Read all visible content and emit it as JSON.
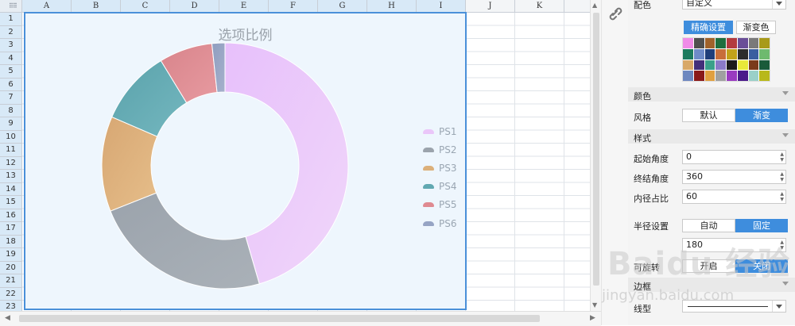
{
  "sheet": {
    "columns": [
      "A",
      "B",
      "C",
      "D",
      "E",
      "F",
      "G",
      "H",
      "I",
      "J",
      "K"
    ],
    "rows": [
      "1",
      "2",
      "3",
      "4",
      "5",
      "6",
      "7",
      "8",
      "9",
      "10",
      "11",
      "12",
      "13",
      "14",
      "15",
      "16",
      "17",
      "18",
      "19",
      "20",
      "21",
      "22",
      "23"
    ]
  },
  "chart_data": {
    "type": "pie",
    "title": "选项比例",
    "donut": true,
    "categories": [
      "PS1",
      "PS2",
      "PS3",
      "PS4",
      "PS5",
      "PS6"
    ],
    "values": [
      45.5,
      23.5,
      12.5,
      9.8,
      7.0,
      1.7
    ],
    "colors": [
      "#eac6f9",
      "#9ba3ac",
      "#dcb07a",
      "#61a8b1",
      "#df8a91",
      "#96a4c4"
    ],
    "start_angle": 0,
    "end_angle": 360,
    "inner_radius_pct": 60,
    "legend_position": "right"
  },
  "panel": {
    "color_scheme_label": "配色",
    "color_scheme_value": "自定义",
    "precise_button": "精确设置",
    "gradient_button": "渐变色",
    "palette": [
      "#f08ce8",
      "#505050",
      "#a0622a",
      "#1f6e3e",
      "#b33b3f",
      "#6a4e97",
      "#7a7a7a",
      "#a89a1a",
      "#1c7a5e",
      "#6e8bc8",
      "#1f3e7a",
      "#c86e3a",
      "#c2a21a",
      "#2c2c2c",
      "#3a5fa0",
      "#6eba6e",
      "#d8a868",
      "#42307a",
      "#3aa08a",
      "#8a7ac8",
      "#1a1a1a",
      "#e8e83a",
      "#7a3a1a",
      "#1a5a3a",
      "#6e88c0",
      "#8a1a1a",
      "#e0a040",
      "#a0a0a0",
      "#9a3ac0",
      "#4a1a8a",
      "#9ad0c8",
      "#b8b81a"
    ],
    "color_section": "颜色",
    "style_label": "风格",
    "style_default": "默认",
    "style_gradient": "渐变",
    "pattern_section": "样式",
    "start_angle_label": "起始角度",
    "start_angle_value": "0",
    "end_angle_label": "终结角度",
    "end_angle_value": "360",
    "inner_ratio_label": "内径占比",
    "inner_ratio_value": "60",
    "radius_label": "半径设置",
    "radius_auto": "自动",
    "radius_fixed": "固定",
    "radius_value": "180",
    "rotatable_label": "可旋转",
    "rotate_on": "开启",
    "rotate_off": "关闭",
    "border_section": "边框",
    "line_type_label": "线型"
  },
  "watermark": {
    "text": "Baidu 经验",
    "url": "jingyan.baidu.com"
  }
}
